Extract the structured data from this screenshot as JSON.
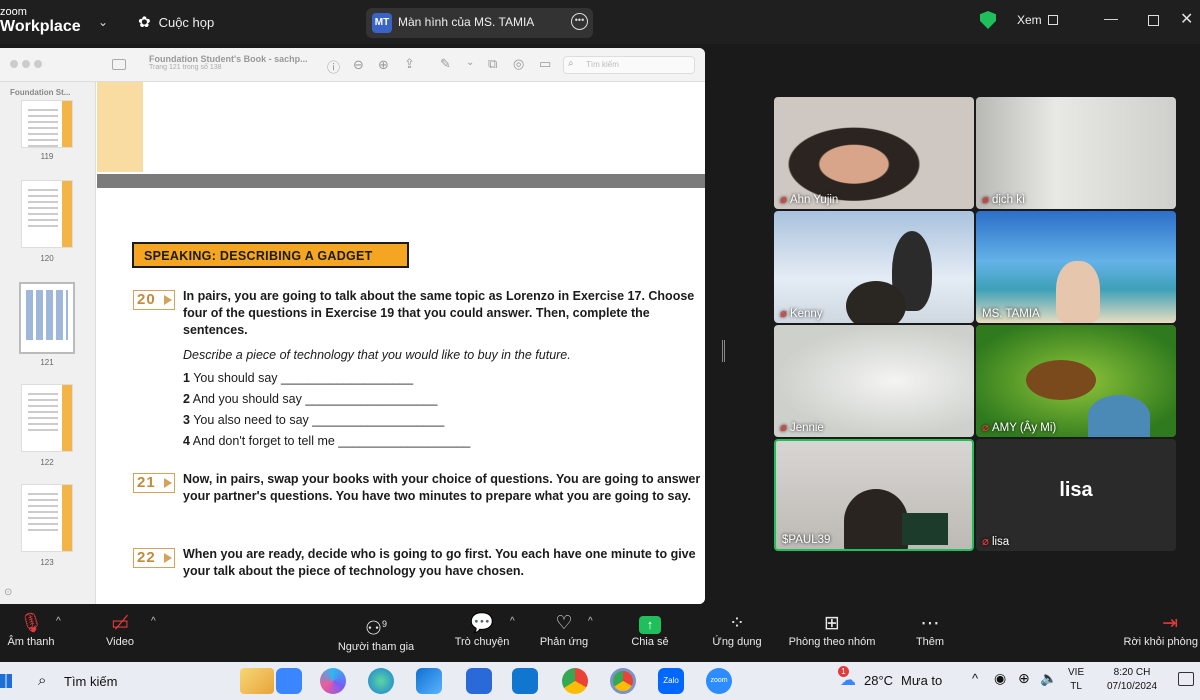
{
  "titlebar": {
    "brand_top": "zoom",
    "brand_bottom": "Workplace",
    "meetings_label": "Cuộc họp",
    "share_initials": "MT",
    "share_title": "Màn hình của MS. TAMIA",
    "view_label": "Xem"
  },
  "doc": {
    "title": "Foundation Student's Book - sachp...",
    "subtitle": "Trang 121 trong số 138",
    "sidebar_title": "Foundation St...",
    "search_placeholder": "Tìm kiếm",
    "thumb_pages": [
      "119",
      "120",
      "121",
      "122",
      "123"
    ],
    "heading": "SPEAKING: DESCRIBING A GADGET",
    "ex20": {
      "num": "20",
      "text": "In pairs, you are going to talk about the same topic as Lorenzo in Exercise 17. Choose four of the questions in Exercise 19 that you could answer. Then, complete the sentences.",
      "prompt": "Describe a piece of technology that you would like to buy in the future.",
      "items": [
        {
          "n": "1",
          "t": "You should say ___________________"
        },
        {
          "n": "2",
          "t": "And you should say ___________________"
        },
        {
          "n": "3",
          "t": "You also need to say ___________________"
        },
        {
          "n": "4",
          "t": "And don't forget to tell me ___________________"
        }
      ]
    },
    "ex21": {
      "num": "21",
      "text": "Now, in pairs, swap your books with your choice of questions. You are going to answer your partner's questions. You have two minutes to prepare what you are going to say."
    },
    "ex22": {
      "num": "22",
      "text": "When you are ready, decide who is going to go first. You each have one minute to give your talk about the piece of technology you have chosen."
    }
  },
  "participants": [
    {
      "name": "Ahn Yujin",
      "muted": true
    },
    {
      "name": "dịch kì",
      "muted": true
    },
    {
      "name": "Kenny",
      "muted": true
    },
    {
      "name": "MS. TAMIA",
      "muted": false
    },
    {
      "name": "Jennie",
      "muted": true
    },
    {
      "name": "AMY (Ây Mi)",
      "muted": true
    },
    {
      "name": "$PAUL39",
      "muted": false
    },
    {
      "name": "lisa",
      "muted": true,
      "big_label": "lisa"
    }
  ],
  "toolbar": {
    "audio": "Âm thanh",
    "video": "Video",
    "participants": "Người tham gia",
    "participants_count": "9",
    "chat": "Trò chuyện",
    "reactions": "Phản ứng",
    "share": "Chia sẻ",
    "apps": "Ứng dụng",
    "breakout": "Phòng theo nhóm",
    "more": "Thêm",
    "leave": "Rời khỏi phòng"
  },
  "taskbar": {
    "search_label": "Tìm kiếm",
    "weather_temp": "28°C",
    "weather_desc": "Mưa to",
    "lang_top": "VIE",
    "lang_bottom": "TL",
    "time": "8:20 CH",
    "date": "07/10/2024",
    "weather_badge": "1",
    "zalo_label": "Zalo",
    "zoom_label": "zoom"
  },
  "colors": {
    "accent_green": "#1fbf5b",
    "heading_orange": "#f4a623",
    "exercise_border": "#d6a25a",
    "muted_red": "#e23b3b"
  }
}
